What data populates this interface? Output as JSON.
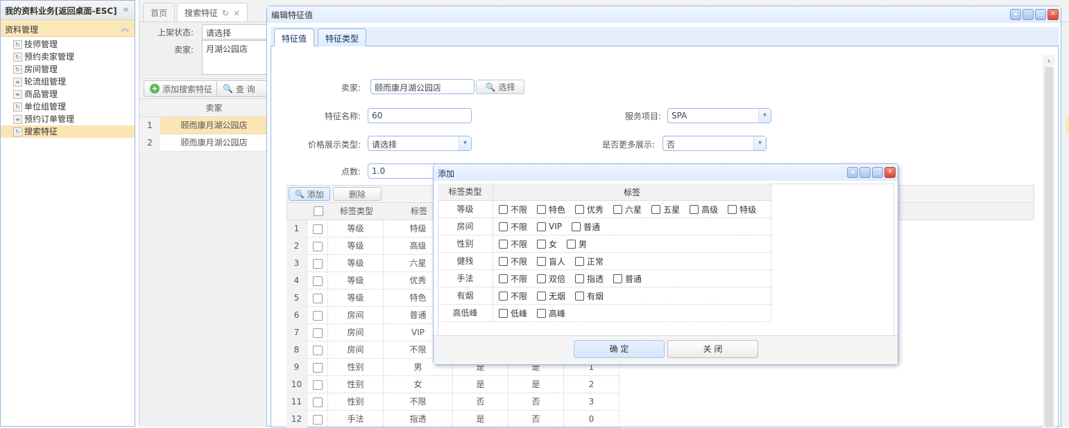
{
  "sidebar": {
    "title": "我的资料业务[返回桌面-ESC]",
    "section": "资料管理",
    "items": [
      {
        "label": "技师管理"
      },
      {
        "label": "预约卖家管理"
      },
      {
        "label": "房间管理"
      },
      {
        "label": "轮流组管理"
      },
      {
        "label": "商品管理"
      },
      {
        "label": "单位组管理"
      },
      {
        "label": "预约订单管理"
      },
      {
        "label": "搜索特征"
      }
    ]
  },
  "tabs": [
    {
      "label": "首页"
    },
    {
      "label": "搜索特征"
    }
  ],
  "bg_filter": {
    "status_label": "上架状态:",
    "status_value": "请选择",
    "seller_label": "卖家:",
    "seller_value": "月湖公园店",
    "add_label": "添加搜索特征",
    "query_label": "查 询"
  },
  "bg_grid": {
    "header_seller": "卖家",
    "rows": [
      {
        "num": "1",
        "seller": "颐而康月湖公园店"
      },
      {
        "num": "2",
        "seller": "颐而康月湖公园店"
      }
    ]
  },
  "edit_window": {
    "title": "编辑特征值",
    "tabs": [
      {
        "label": "特征值"
      },
      {
        "label": "特征类型"
      }
    ],
    "form": {
      "seller_label": "卖家:",
      "seller_value": "颐而康月湖公园店",
      "select_label": "选择",
      "name_label": "特征名称:",
      "name_value": "60",
      "service_label": "服务项目:",
      "service_value": "SPA",
      "price_label": "价格展示类型:",
      "price_value": "请选择",
      "more_label": "是否更多展示:",
      "more_value": "否",
      "points_label": "点数:",
      "points_value": "1.0"
    },
    "grid": {
      "add_label": "添加",
      "delete_label": "删除",
      "col_type": "标签类型",
      "col_tag": "标签",
      "rows": [
        {
          "num": "1",
          "type": "等级",
          "tag": "特级",
          "c1": "",
          "c2": "",
          "c3": ""
        },
        {
          "num": "2",
          "type": "等级",
          "tag": "高级",
          "c1": "",
          "c2": "",
          "c3": ""
        },
        {
          "num": "3",
          "type": "等级",
          "tag": "六星",
          "c1": "",
          "c2": "",
          "c3": ""
        },
        {
          "num": "4",
          "type": "等级",
          "tag": "优秀",
          "c1": "",
          "c2": "",
          "c3": ""
        },
        {
          "num": "5",
          "type": "等级",
          "tag": "特色",
          "c1": "",
          "c2": "",
          "c3": ""
        },
        {
          "num": "6",
          "type": "房间",
          "tag": "普通",
          "c1": "",
          "c2": "",
          "c3": ""
        },
        {
          "num": "7",
          "type": "房间",
          "tag": "VIP",
          "c1": "",
          "c2": "",
          "c3": ""
        },
        {
          "num": "8",
          "type": "房间",
          "tag": "不限",
          "c1": "",
          "c2": "",
          "c3": ""
        },
        {
          "num": "9",
          "type": "性别",
          "tag": "男",
          "c1": "是",
          "c2": "是",
          "c3": "1"
        },
        {
          "num": "10",
          "type": "性别",
          "tag": "女",
          "c1": "是",
          "c2": "是",
          "c3": "2"
        },
        {
          "num": "11",
          "type": "性别",
          "tag": "不限",
          "c1": "否",
          "c2": "否",
          "c3": "3"
        },
        {
          "num": "12",
          "type": "手法",
          "tag": "指透",
          "c1": "是",
          "c2": "否",
          "c3": "0"
        }
      ]
    }
  },
  "add_dialog": {
    "title": "添加",
    "col_type": "标签类型",
    "col_tags": "标签",
    "rows": [
      {
        "type": "等级",
        "options": [
          "不限",
          "特色",
          "优秀",
          "六星",
          "五星",
          "高级",
          "特级"
        ]
      },
      {
        "type": "房间",
        "options": [
          "不限",
          "VIP",
          "普通"
        ]
      },
      {
        "type": "性别",
        "options": [
          "不限",
          "女",
          "男"
        ]
      },
      {
        "type": "健残",
        "options": [
          "不限",
          "盲人",
          "正常"
        ]
      },
      {
        "type": "手法",
        "options": [
          "不限",
          "双倍",
          "指透",
          "普通"
        ]
      },
      {
        "type": "有烟",
        "options": [
          "不限",
          "无烟",
          "有烟"
        ]
      },
      {
        "type": "高低峰",
        "options": [
          "低峰",
          "高峰"
        ]
      }
    ],
    "ok_label": "确 定",
    "close_label": "关 闭"
  }
}
